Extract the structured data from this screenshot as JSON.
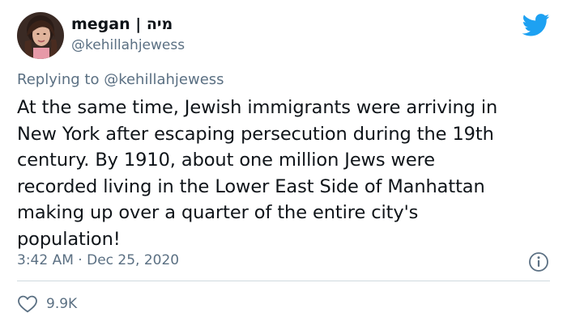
{
  "author": {
    "display_name": "megan | מיה",
    "handle": "@kehillahjewess"
  },
  "reply": {
    "prefix": "Replying to ",
    "mention": "@kehillahjewess"
  },
  "tweet": {
    "lines": [
      "At the same time, Jewish immigrants were arriving in",
      "New York after escaping persecution during the 19th",
      "century. By 1910, about one million Jews were",
      "recorded living in the Lower East Side of Manhattan",
      "making up over a quarter of the entire city's",
      "population!"
    ]
  },
  "meta": {
    "time": "3:42 AM",
    "separator": " · ",
    "date": "Dec 25, 2020"
  },
  "stats": {
    "likes": "9.9K"
  },
  "icons": {
    "brand": "twitter-bird-icon",
    "info": "info-icon",
    "like": "heart-icon"
  },
  "colors": {
    "brand": "#1da1f2",
    "text": "#0f1419",
    "secondary": "#5b7083",
    "divider": "#cfd9de"
  }
}
